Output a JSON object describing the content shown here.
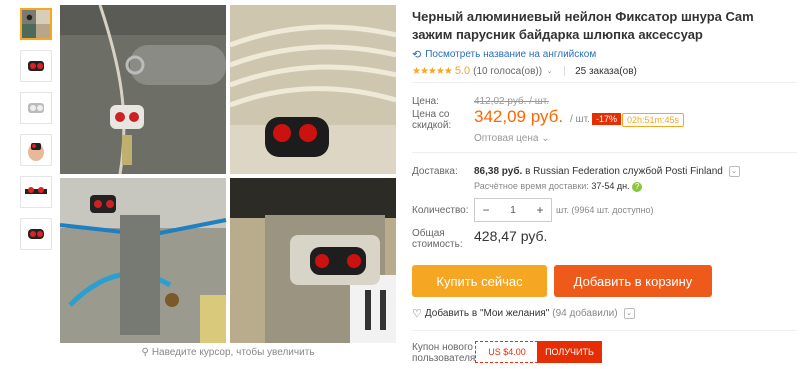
{
  "product": {
    "title": "Черный алюминиевый нейлон Фиксатор шнура Cam зажим парусник байдарка шлюпка аксессуар",
    "translate_link": "Посмотреть название на английском",
    "rating_stars": "★★★★★",
    "rating_score": "5.0",
    "votes": "(10 голоса(ов))",
    "orders": "25 заказа(ов)"
  },
  "price": {
    "label": "Цена:",
    "old": "412,02 руб. / шт.",
    "sale_label_1": "Цена со",
    "sale_label_2": "скидкой:",
    "sale": "342,09 руб.",
    "unit": "/ шт.",
    "discount": "-17%",
    "timer": "02h:51m:45s",
    "wholesale": "Оптовая цена"
  },
  "shipping": {
    "label": "Доставка:",
    "price": "86,38 руб.",
    "to": "в Russian Federation службой Posti Finland",
    "time_label": "Расчётное время доставки:",
    "time_value": "37-54 дн."
  },
  "quantity": {
    "label": "Количество:",
    "minus": "−",
    "value": "1",
    "plus": "+",
    "stock": "шт. (9964 шт. доступно)"
  },
  "total": {
    "label_1": "Общая",
    "label_2": "стоимость:",
    "value": "428,47 руб."
  },
  "buttons": {
    "buy_now": "Купить сейчас",
    "add_to_cart": "Добавить в корзину"
  },
  "wishlist": {
    "text": "Добавить в \"Мои желания\"",
    "count": "(94 добавили)"
  },
  "coupon": {
    "label_1": "Купон нового",
    "label_2": "пользователя",
    "value": "US $4.00",
    "button": "ПОЛУЧИТЬ"
  },
  "gallery": {
    "zoom_hint": "Наведите курсор, чтобы увеличить"
  },
  "colors": {
    "accent_orange": "#f5a623",
    "cart_orange": "#ee5a19",
    "sale_price": "#f60",
    "discount_red": "#e62e04",
    "link_blue": "#2a6ebb"
  }
}
